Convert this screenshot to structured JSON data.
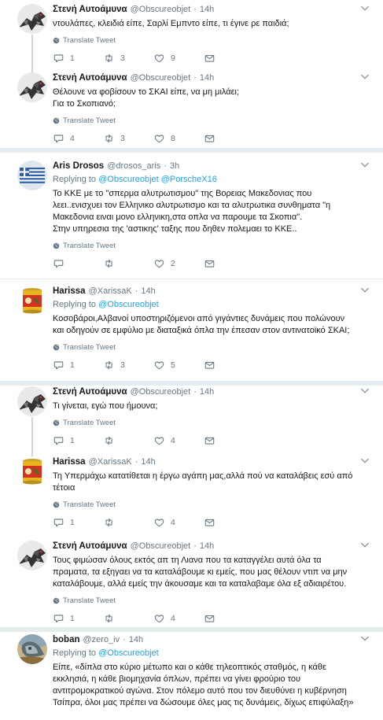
{
  "app": "Twitter",
  "translate_label": "Translate Tweet",
  "replying_prefix": "Replying to",
  "tweets": [
    {
      "name": "Στενή Αυτοάμυνα",
      "handle": "@Obscureobjet",
      "time": "14h",
      "avatar": "bird-camouflage-avatar",
      "text": "ντουλάπες, κλειδιά είπε, Σαρλί Εμπντο είπε, τι έγινε ρε παιδιά;",
      "replies": "1",
      "retweets": "3",
      "likes": "9"
    },
    {
      "name": "Στενή Αυτοάμυνα",
      "handle": "@Obscureobjet",
      "time": "14h",
      "avatar": "bird-camouflage-avatar",
      "text_lines": [
        "Θέλουνε να φοβίσουν το ΣΚΑΙ είπε, να μη μιλάει;",
        "Για το Σκοπιανό;"
      ],
      "replies": "4",
      "retweets": "3",
      "likes": "8"
    },
    {
      "name": "Aris Drosos",
      "handle": "@drosos_aris",
      "time": "3h",
      "avatar": "greek-flag-avatar",
      "replying_to": "@Obscureobjet @PorscheX16",
      "text_lines": [
        "Το ΚΚΕ με το \"σπερμα αλυτρωτισμου\" της Βορειας Μακεδονιας που",
        "λεει..ενισχυει τον Ελληνικο αλυτρωτισμο και τα αλυτρωτικα συνθηματα \"η",
        "Μακεδονια ειναι μονο ελληνικη,στα οπλα να παρουμε τα Σκοπια\".",
        "Στην υπηρεσια της 'αστικης' ταξης που δηθεν πολεμαει το ΚΚΕ.."
      ],
      "replies": "",
      "retweets": "",
      "likes": "2"
    },
    {
      "name": "Harissa",
      "handle": "@XarissaK",
      "time": "14h",
      "avatar": "harissa-can-avatar",
      "replying_to": "@Obscureobjet",
      "text_lines": [
        "Κοσοβάροι,Αλβανοί υποστηριζόμενοι από γιγάντιες δυνάμεις που πολώνουν",
        "και οδηγούν σε εμφύλιο με διαταξικά όπλα την έπεσαν στον αντινατοϊκό ΣΚΑΙ;"
      ],
      "replies": "1",
      "retweets": "3",
      "likes": "5"
    },
    {
      "name": "Στενή Αυτοάμυνα",
      "handle": "@Obscureobjet",
      "time": "14h",
      "avatar": "bird-camouflage-avatar",
      "text": "Τι γίνεται, εγώ που ήμουνα;",
      "replies": "1",
      "retweets": "",
      "likes": "4"
    },
    {
      "name": "Harissa",
      "handle": "@XarissaK",
      "time": "14h",
      "avatar": "harissa-can-avatar",
      "text_lines": [
        "Τη Υπερμάχω κατατίθεται η έργω αγάπη μας,αλλά πού να καταλάβεις εσύ από",
        "τέτοια"
      ],
      "replies": "1",
      "retweets": "",
      "likes": "4"
    },
    {
      "name": "Στενή Αυτοάμυνα",
      "handle": "@Obscureobjet",
      "time": "14h",
      "avatar": "bird-camouflage-avatar",
      "text_lines": [
        "Τους φιμώσαν όλους εκτός απ τη Λιανα που τα καταγγέλει αυτά όλα τα",
        "πραματα, τα εξηγαει να τα καταλάβουμε κι εμείς, που μας θέλουν ντιπ να μην",
        "καταλάβουμε, αλλά εμείς την άκουσαμε και τα καταλαβαμε όλα εξ αδιαιρέτου."
      ],
      "replies": "1",
      "retweets": "",
      "likes": "4"
    },
    {
      "name": "boban",
      "handle": "@zero_iv",
      "time": "14h",
      "avatar": "painting-avatar",
      "replying_to": "@Obscureobjet",
      "text_lines": [
        "Είπε, «δίπλα στο κύριο μέτωπο και ο κάθε τηλεοπτικός σταθμός, η κάθε",
        "εκκλησιά, η κάθε βιομηχανία όπλων, πρέπει να γίνει φρούριο του",
        "αντιτρομοκρατικού αγώνα. Στον πόλεμο αυτό που τον διευθύνει η κυβέρνηση",
        "Τσίπρα, όλοι μας πρέπει να δώσουμε όλες μας τις δυνάμεις, δίχως επιφύλαξη»"
      ]
    }
  ]
}
